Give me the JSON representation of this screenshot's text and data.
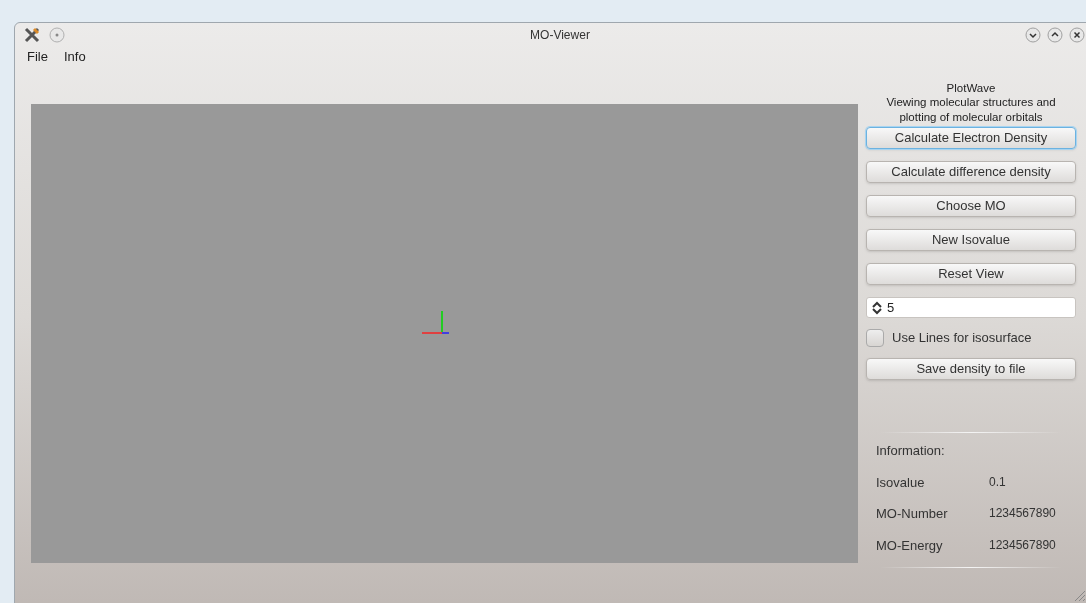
{
  "window": {
    "title": "MO-Viewer"
  },
  "menu": [
    "File",
    "Info"
  ],
  "panel": {
    "heading": "PlotWave",
    "description": "Viewing molecular structures and plotting of molecular orbitals",
    "controls": [
      {
        "kind": "button",
        "label": "Calculate Electron Density",
        "focused": true
      },
      {
        "kind": "button",
        "label": "Calculate difference density",
        "focused": false
      },
      {
        "kind": "button",
        "label": "Choose MO",
        "focused": false
      },
      {
        "kind": "button",
        "label": "New Isovalue",
        "focused": false
      },
      {
        "kind": "button",
        "label": "Reset View",
        "focused": false
      },
      {
        "kind": "spinbox",
        "value": "5"
      },
      {
        "kind": "checkbox",
        "label": "Use Lines for isosurface",
        "checked": false
      },
      {
        "kind": "button",
        "label": "Save density to file",
        "focused": false
      }
    ]
  },
  "information": {
    "title": "Information:",
    "rows": [
      {
        "label": "Isovalue",
        "value": "0.1"
      },
      {
        "label": "MO-Number",
        "value": "1234567890"
      },
      {
        "label": "MO-Energy",
        "value": "1234567890"
      }
    ]
  }
}
